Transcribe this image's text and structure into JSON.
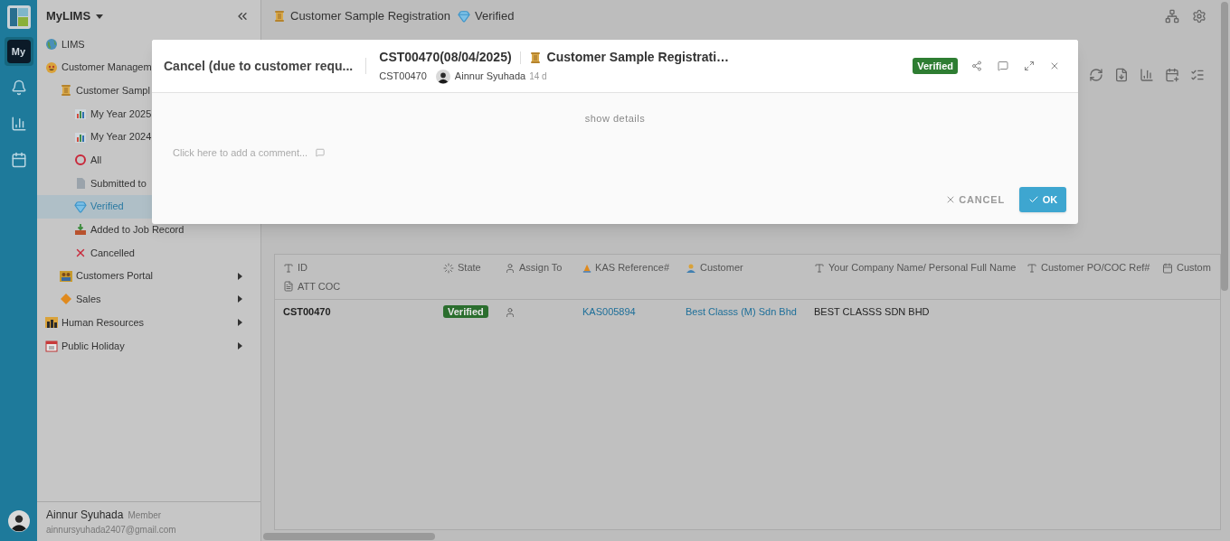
{
  "rail": {
    "items": [
      {
        "kind": "my",
        "label": "My",
        "selected": true
      },
      {
        "kind": "bell",
        "selected": false
      },
      {
        "kind": "chart",
        "selected": false
      },
      {
        "kind": "calendar",
        "selected": false
      }
    ]
  },
  "sidebar": {
    "title": "MyLIMS",
    "items": [
      {
        "kind": "globe",
        "label": "LIMS",
        "selected": false
      },
      {
        "kind": "smiley",
        "label": "Customer Managem",
        "selected": false,
        "expanded": true,
        "children": [
          {
            "kind": "scroll",
            "label": "Customer Sampl",
            "selected": false,
            "expanded": true,
            "children": [
              {
                "kind": "barchart",
                "label": "My Year 2025",
                "selected": false
              },
              {
                "kind": "barchart",
                "label": "My Year 2024",
                "selected": false
              },
              {
                "kind": "ring",
                "label": "All",
                "selected": false
              },
              {
                "kind": "doc",
                "label": "Submitted to",
                "selected": false
              },
              {
                "kind": "gem",
                "label": "Verified",
                "selected": true
              },
              {
                "kind": "tray",
                "label": "Added to Job Record",
                "selected": false
              },
              {
                "kind": "cross",
                "label": "Cancelled",
                "selected": false
              }
            ]
          },
          {
            "kind": "people",
            "label": "Customers Portal",
            "selected": false,
            "expanded": false
          },
          {
            "kind": "diamond",
            "label": "Sales",
            "selected": false,
            "expanded": false
          }
        ]
      },
      {
        "kind": "city",
        "label": "Human Resources",
        "selected": false,
        "expanded": false
      },
      {
        "kind": "datebook",
        "label": "Public Holiday",
        "selected": false,
        "expanded": false
      }
    ],
    "user": {
      "name": "Ainnur Syuhada",
      "role": "Member",
      "email": "ainnursyuhada2407@gmail.com"
    }
  },
  "header": {
    "breadcrumb": [
      {
        "kind": "scroll",
        "label": "Customer Sample Registration"
      },
      {
        "kind": "gem",
        "label": "Verified"
      }
    ]
  },
  "table": {
    "columns": [
      {
        "kind": "text",
        "label": "ID"
      },
      {
        "kind": "state",
        "label": "State"
      },
      {
        "kind": "person",
        "label": "Assign To"
      },
      {
        "kind": "cone",
        "label": "KAS Reference#"
      },
      {
        "kind": "contact",
        "label": "Customer"
      },
      {
        "kind": "text",
        "label": "Your Company Name/ Personal Full Name"
      },
      {
        "kind": "text",
        "label": "Customer PO/COC Ref#"
      },
      {
        "kind": "date",
        "label": "Custom"
      },
      {
        "kind": "file",
        "label": "ATT COC"
      }
    ],
    "rows": [
      {
        "cells": [
          {
            "kind": "bold",
            "text": "CST00470"
          },
          {
            "kind": "badge",
            "text": "Verified"
          },
          {
            "kind": "assignee"
          },
          {
            "kind": "link",
            "text": "KAS005894"
          },
          {
            "kind": "link",
            "text": "Best Classs (M) Sdn Bhd"
          },
          {
            "kind": "plain",
            "text": "BEST CLASSS SDN BHD"
          }
        ]
      }
    ]
  },
  "modal": {
    "action": "Cancel (due to customer requ...",
    "record_title": "CST00470(08/04/2025)",
    "form_title": "Customer Sample Registrati…",
    "record_id": "CST00470",
    "author": "Ainnur Syuhada",
    "age": "14 d",
    "status": "Verified",
    "show_details": "show details",
    "comment": {
      "placeholder": "Click here to add a comment..."
    },
    "cancel": "CANCEL",
    "ok": "OK"
  }
}
